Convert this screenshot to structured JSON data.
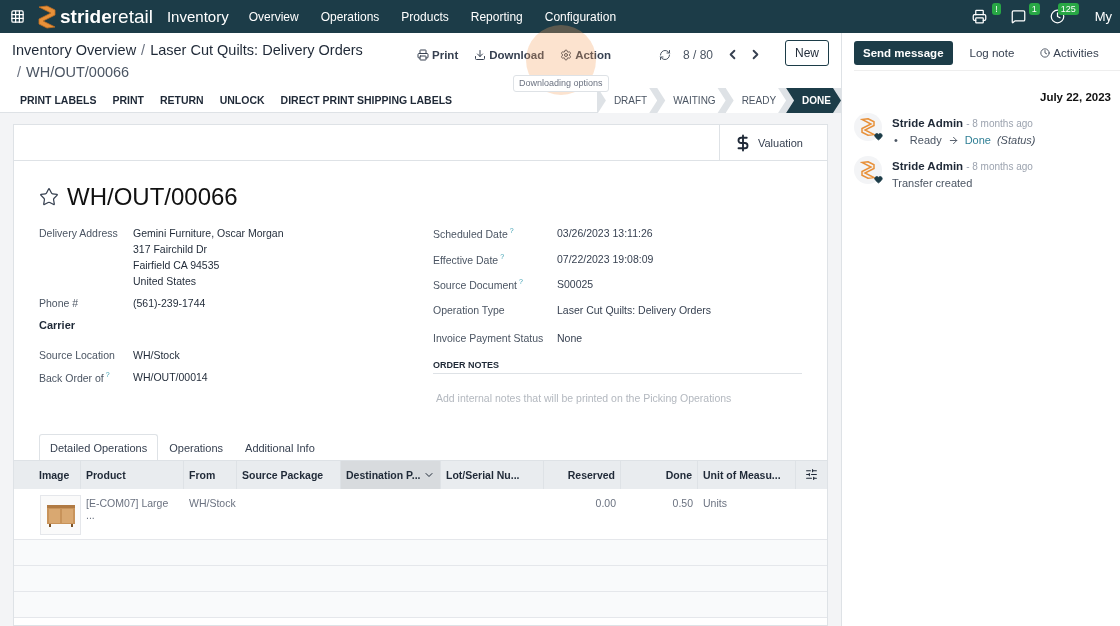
{
  "navbar": {
    "brand": {
      "first": "stride",
      "second": "retail"
    },
    "app": "Inventory",
    "menu": [
      "Overview",
      "Operations",
      "Products",
      "Reporting",
      "Configuration"
    ],
    "systray": [
      {
        "kind": "printer",
        "badge": "!"
      },
      {
        "kind": "chat",
        "badge": "1"
      },
      {
        "kind": "clock",
        "badge": "125"
      }
    ],
    "user": "My"
  },
  "breadcrumb": {
    "items": [
      "Inventory Overview",
      "Laser Cut Quilts: Delivery Orders"
    ],
    "current": "WH/OUT/00066",
    "separator": "/"
  },
  "actions": [
    {
      "kind": "print",
      "label": "Print"
    },
    {
      "kind": "download",
      "label": "Download"
    },
    {
      "kind": "gear",
      "label": "Action"
    }
  ],
  "tooltip": "Downloading options",
  "pager": "8 / 80",
  "new_button": "New",
  "buttons": [
    "PRINT LABELS",
    "PRINT",
    "RETURN",
    "UNLOCK",
    "DIRECT PRINT SHIPPING LABELS"
  ],
  "stages": [
    {
      "label": "DRAFT",
      "selected": false
    },
    {
      "label": "WAITING",
      "selected": false
    },
    {
      "label": "READY",
      "selected": false
    },
    {
      "label": "DONE",
      "selected": true
    }
  ],
  "valuation": "Valuation",
  "record": {
    "title": "WH/OUT/00066",
    "starred": false
  },
  "left_fields": [
    {
      "kind": "field",
      "label": "Delivery Address",
      "help": false,
      "lines": [
        "Gemini Furniture, Oscar Morgan",
        "317 Fairchild Dr",
        "Fairfield CA 94535",
        "United States"
      ]
    },
    {
      "kind": "field",
      "label": "Phone #",
      "help": false,
      "lines": [
        "(561)-239-1744"
      ]
    },
    {
      "kind": "heading",
      "label": "Carrier"
    },
    {
      "kind": "field",
      "label": "Source Location",
      "help": false,
      "lines": [
        "WH/Stock"
      ]
    },
    {
      "kind": "field",
      "label": "Back Order of",
      "help": true,
      "lines": [
        "WH/OUT/00014"
      ]
    }
  ],
  "right_fields": [
    {
      "label": "Scheduled Date",
      "help": true,
      "value": "03/26/2023 13:11:26"
    },
    {
      "label": "Effective Date",
      "help": true,
      "value": "07/22/2023 19:08:09"
    },
    {
      "label": "Source Document",
      "help": true,
      "value": "S00025"
    },
    {
      "label": "Operation Type",
      "help": false,
      "value": "Laser Cut Quilts: Delivery Orders"
    },
    {
      "label": "Invoice Payment Status",
      "help": false,
      "value": "None"
    }
  ],
  "help_mark": "?",
  "order_notes": {
    "title": "ORDER NOTES",
    "placeholder": "Add internal notes that will be printed on the Picking Operations"
  },
  "tabs": [
    {
      "label": "Detailed Operations",
      "selected": true
    },
    {
      "label": "Operations",
      "selected": false
    },
    {
      "label": "Additional Info",
      "selected": false
    }
  ],
  "table": {
    "columns": [
      {
        "label": "Image",
        "kind": "text",
        "sorted": false
      },
      {
        "label": "Product",
        "kind": "text",
        "sorted": false
      },
      {
        "label": "From",
        "kind": "text",
        "sorted": false
      },
      {
        "label": "Source Package",
        "kind": "text",
        "sorted": false
      },
      {
        "label": "Destination P...",
        "kind": "text",
        "sorted": true
      },
      {
        "label": "Lot/Serial Nu...",
        "kind": "text",
        "sorted": false
      },
      {
        "label": "Reserved",
        "kind": "number",
        "sorted": false
      },
      {
        "label": "Done",
        "kind": "number",
        "sorted": false
      },
      {
        "label": "Unit of Measu...",
        "kind": "text",
        "sorted": false
      }
    ],
    "rows": [
      {
        "cells": [
          {
            "kind": "picture"
          },
          "[E-COM07] Large ...",
          "WH/Stock",
          "",
          "",
          "",
          "0.00",
          "0.50",
          "Units"
        ]
      }
    ]
  },
  "chatter": {
    "buttons": [
      {
        "label": "Send message",
        "primary": true
      },
      {
        "label": "Log note",
        "primary": false
      },
      {
        "label": "Activities",
        "primary": false
      }
    ],
    "date": "July 22, 2023",
    "messages": [
      {
        "author": "Stride Admin",
        "time": "- 8 months ago",
        "kind": "tracking",
        "bullet": "•",
        "from": "Ready",
        "to": "Done",
        "field": "(Status)"
      },
      {
        "author": "Stride Admin",
        "time": "- 8 months ago",
        "kind": "text",
        "body": "Transfer created"
      }
    ]
  }
}
